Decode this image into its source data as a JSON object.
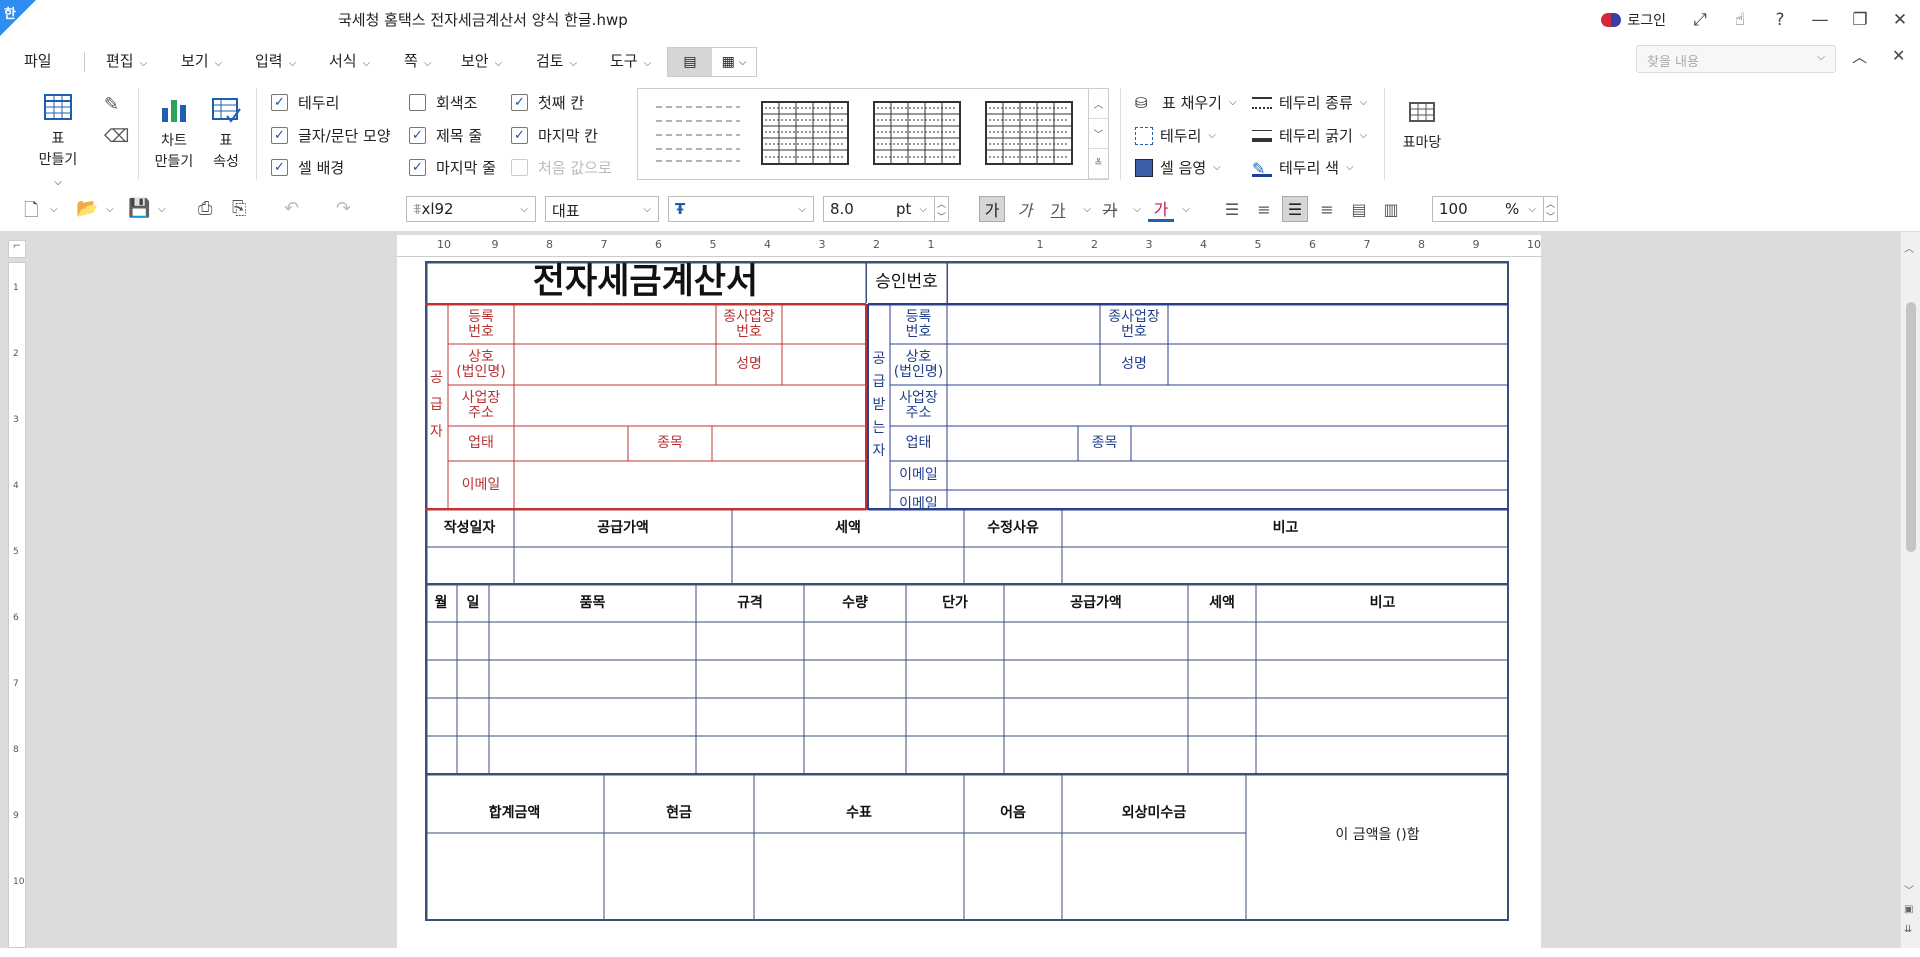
{
  "app": {
    "logo": "한",
    "doc_title": "국세청 홈택스 전자세금계산서 양식 한글.hwp",
    "login_label": "로그인"
  },
  "window_icons": [
    "expand-icon",
    "touch-icon",
    "help-icon",
    "minimize-icon",
    "restore-icon",
    "close-icon"
  ],
  "menus": [
    "파일",
    "편집",
    "보기",
    "입력",
    "서식",
    "쪽",
    "보안",
    "검토",
    "도구"
  ],
  "search": {
    "placeholder": "찾을 내용"
  },
  "ribbon": {
    "table_btn": [
      "표",
      "만들기"
    ],
    "chart_btn": [
      "차트",
      "만들기"
    ],
    "props_btn": [
      "표",
      "속성"
    ],
    "checks": [
      {
        "label": "테두리",
        "checked": true
      },
      {
        "label": "회색조",
        "checked": false
      },
      {
        "label": "첫째 칸",
        "checked": true
      },
      {
        "label": "글자/문단 모양",
        "checked": true
      },
      {
        "label": "제목 줄",
        "checked": true
      },
      {
        "label": "마지막 칸",
        "checked": true
      },
      {
        "label": "셀 배경",
        "checked": true
      },
      {
        "label": "마지막 줄",
        "checked": true
      },
      {
        "label": "처음 값으로",
        "checked": false,
        "disabled": true
      }
    ],
    "tools": [
      "표 채우기",
      "테두리",
      "셀 음영",
      "테두리 종류",
      "테두리 굵기",
      "테두리 색"
    ],
    "table_handle": "표마당"
  },
  "toolbar": {
    "style": "xl92",
    "font_group": "대표",
    "font": "",
    "size": "8.0",
    "unit": "pt",
    "zoom": "100",
    "zoom_unit": "%",
    "bold_glyph": "가",
    "italic_glyph": "가",
    "underline_glyph": "가",
    "strike_glyph": "가",
    "color_glyph": "가"
  },
  "ruler": {
    "h": [
      "10",
      "9",
      "8",
      "7",
      "6",
      "5",
      "4",
      "3",
      "2",
      "1",
      "",
      "1",
      "2",
      "3",
      "4",
      "5",
      "6",
      "7",
      "8",
      "9",
      "10"
    ],
    "v": [
      "1",
      "2",
      "3",
      "4",
      "5",
      "6",
      "7",
      "8",
      "9",
      "10"
    ]
  },
  "form": {
    "title": "전자세금계산서",
    "approval_label": "승인번호",
    "supplier": {
      "side": [
        "공",
        "급",
        "자"
      ],
      "reg_no": [
        "등록",
        "번호"
      ],
      "sub_biz": [
        "종사업장",
        "번호"
      ],
      "company": [
        "상호",
        "(법인명)"
      ],
      "name": "성명",
      "address": [
        "사업장",
        "주소"
      ],
      "biz_type": "업태",
      "item": "종목",
      "email": "이메일"
    },
    "receiver": {
      "side": [
        "공",
        "급",
        "받",
        "는",
        "자"
      ],
      "reg_no": [
        "등록",
        "번호"
      ],
      "sub_biz": [
        "종사업장",
        "번호"
      ],
      "company": [
        "상호",
        "(법인명)"
      ],
      "name": "성명",
      "address": [
        "사업장",
        "주소"
      ],
      "biz_type": "업태",
      "item": "종목",
      "email1": "이메일",
      "email2": "이메일"
    },
    "summary_headers": [
      "작성일자",
      "공급가액",
      "세액",
      "수정사유",
      "비고"
    ],
    "item_headers": [
      "월",
      "일",
      "품목",
      "규격",
      "수량",
      "단가",
      "공급가액",
      "세액",
      "비고"
    ],
    "total_headers": [
      "합계금액",
      "현금",
      "수표",
      "어음",
      "외상미수금"
    ],
    "claim_text": "이  금액을  ()함"
  }
}
